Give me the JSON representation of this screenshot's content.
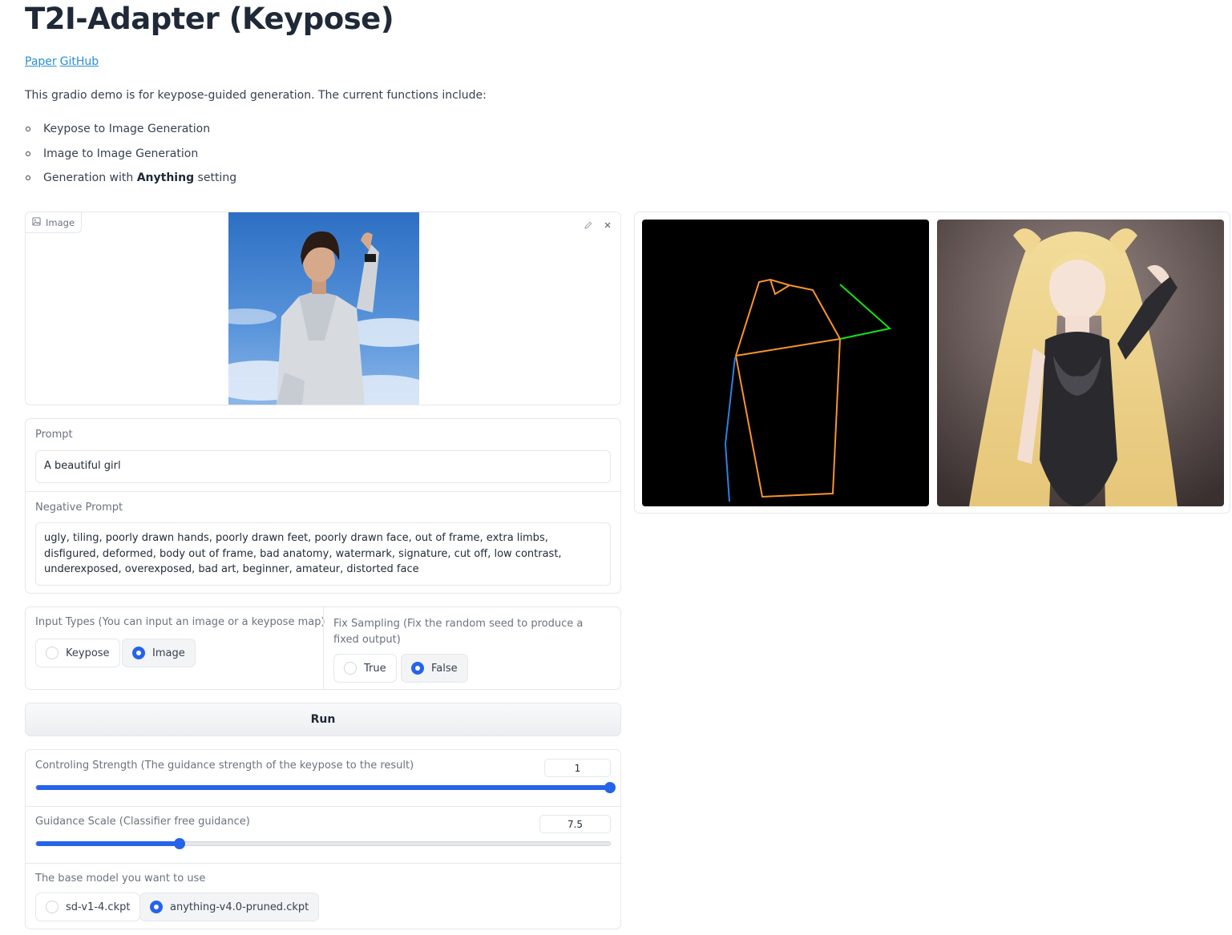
{
  "header": {
    "title": "T2I-Adapter (Keypose)",
    "links": [
      "Paper",
      "GitHub"
    ],
    "description": "This gradio demo is for keypose-guided generation. The current functions include:",
    "features": [
      {
        "text": "Keypose to Image Generation"
      },
      {
        "text": "Image to Image Generation"
      },
      {
        "prefix": "Generation with ",
        "bold": "Anything",
        "suffix": " setting"
      }
    ]
  },
  "image_input": {
    "label": "Image",
    "icons": [
      "image-icon",
      "edit-icon",
      "close-icon"
    ]
  },
  "prompt": {
    "label": "Prompt",
    "value": "A beautiful girl"
  },
  "negative_prompt": {
    "label": "Negative Prompt",
    "value": "ugly, tiling, poorly drawn hands, poorly drawn feet, poorly drawn face, out of frame, extra limbs, disfigured, deformed, body out of frame, bad anatomy, watermark, signature, cut off, low contrast, underexposed, overexposed, bad art, beginner, amateur, distorted face"
  },
  "input_types": {
    "label": "Input Types (You can input an image or a keypose map)",
    "options": [
      "Keypose",
      "Image"
    ],
    "selected": "Image"
  },
  "fix_sampling": {
    "label": "Fix Sampling (Fix the random seed to produce a fixed output)",
    "options": [
      "True",
      "False"
    ],
    "selected": "False"
  },
  "run_button": {
    "label": "Run"
  },
  "controlling_strength": {
    "label": "Controling Strength (The guidance strength of the keypose to the result)",
    "value": "1",
    "fraction": 1.0
  },
  "guidance_scale": {
    "label": "Guidance Scale (Classifier free guidance)",
    "value": "7.5",
    "fraction": 0.25
  },
  "base_model": {
    "label": "The base model you want to use",
    "options": [
      "sd-v1-4.ckpt",
      "anything-v4.0-pruned.ckpt"
    ],
    "selected": "anything-v4.0-pruned.ckpt"
  },
  "colors": {
    "accent": "#2563eb",
    "link": "#2c8ed1",
    "pose_orange": "#f7942f",
    "pose_green": "#16e017",
    "pose_blue": "#2f7fe0"
  }
}
